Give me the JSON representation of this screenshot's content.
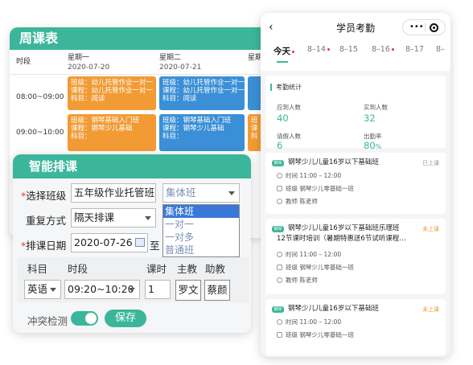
{
  "weekly": {
    "title": "周课表",
    "time_header": "时段",
    "days": [
      {
        "name": "星期一",
        "date": "2020-07-20"
      },
      {
        "name": "星期二",
        "date": "2020-07-21"
      },
      {
        "name": "星期"
      }
    ],
    "slots": [
      "08:00~09:00",
      "09:00~10:00"
    ],
    "cells": [
      {
        "class": "班级：幼儿托管作业一对一",
        "course": "课程：幼儿托管作业一对一",
        "subject": "科目：阅读",
        "color": "#f29b34"
      },
      {
        "class": "班级：幼儿托管作业一对一",
        "course": "课程：幼儿托管作业一对一",
        "subject": "科目：阅读",
        "color": "#3a8fd6"
      },
      {
        "class": "班级：钢琴基础入门班",
        "course": "课程：钢琴少儿基础",
        "subject": "科目：",
        "color": "#f29b34"
      },
      {
        "class": "班级：钢琴基础入门班",
        "course": "课程：钢琴少儿基础",
        "subject": "科目：",
        "color": "#3a8fd6"
      }
    ],
    "partial": [
      "班",
      "课",
      "科"
    ]
  },
  "smart": {
    "title": "智能排课",
    "class_label": "选择班级",
    "class_value": "五年级作业托管班",
    "type_value": "集体班",
    "type_options": [
      "集体班",
      "一对一",
      "一对多",
      "普通班"
    ],
    "repeat_label": "重复方式",
    "repeat_value": "隔天排课",
    "date_label": "排课日期",
    "date_value": "2020-07-26",
    "date_to": "至",
    "cols": {
      "subject": "科目",
      "time": "时段",
      "hours": "课时",
      "teacher": "主教",
      "assistant": "助教"
    },
    "row": {
      "subject": "英语",
      "time": "09:20~10:20",
      "hours": "1",
      "teacher": "罗文",
      "assistant": "蔡颜"
    },
    "conflict_label": "冲突检测",
    "save_label": "保存",
    "required_mark": "*"
  },
  "phone": {
    "back": "‹",
    "title": "学员考勤",
    "capsule_dots": "•••",
    "tabs": [
      {
        "label": "今天",
        "dot": true
      },
      {
        "label": "8–14",
        "dot": true
      },
      {
        "label": "8–15",
        "dot": false
      },
      {
        "label": "8–16",
        "dot": true
      },
      {
        "label": "8–17",
        "dot": false
      },
      {
        "label": "8–",
        "dot": false
      }
    ],
    "stats": {
      "title": "考勤统计",
      "expected_label": "应到人数",
      "expected_value": "40",
      "actual_label": "实到人数",
      "actual_value": "32",
      "leave_label": "请假人数",
      "leave_value": "6",
      "rate_label": "出勤率",
      "rate_value": "80",
      "rate_unit": "%"
    },
    "lessons": [
      {
        "badge": "钢琴",
        "title": "钢琴少儿儿童16岁以下基础班",
        "title2": "",
        "status": "已上课",
        "status_color": "#999999",
        "time": "时间 11:00 – 12:00",
        "class": "班级 钢琴少儿零基础一班",
        "teacher": "教师 陈老师"
      },
      {
        "badge": "钢琴",
        "title": "钢琴少儿儿童16岁以下基础班乐理班",
        "title2": "12节课时培训（暑期特惠送6节试听课程…",
        "status": "未上课",
        "status_color": "#f29b34",
        "time": "时间 11:00 – 12:00",
        "class": "班级 钢琴少儿零基础一班",
        "teacher": "教师 陈老师"
      },
      {
        "badge": "钢琴",
        "title": "钢琴少儿儿童16岁以下基础班",
        "title2": "",
        "status": "未上课",
        "status_color": "#f29b34",
        "time": "时间 11:00 – 12:00",
        "class": "班级 钢琴少儿零基础一班",
        "teacher": ""
      }
    ]
  }
}
